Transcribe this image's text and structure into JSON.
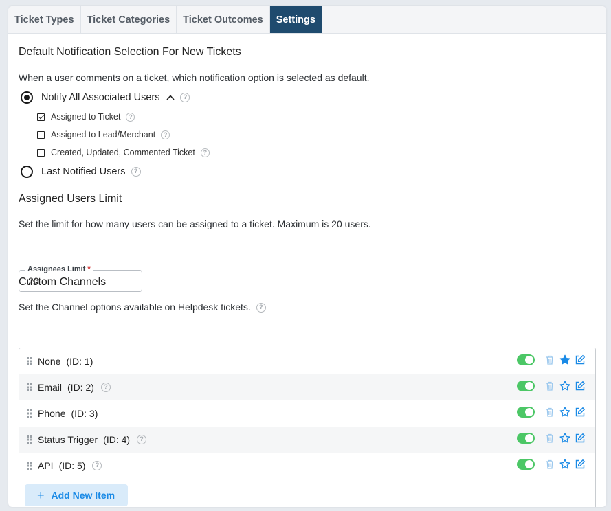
{
  "tabs": [
    {
      "label": "Ticket Types",
      "active": false
    },
    {
      "label": "Ticket Categories",
      "active": false
    },
    {
      "label": "Ticket Outcomes",
      "active": false
    },
    {
      "label": "Settings",
      "active": true
    }
  ],
  "notification": {
    "heading": "Default Notification Selection For New Tickets",
    "description": "When a user comments on a ticket, which notification option is selected as default.",
    "options": [
      {
        "label": "Notify All Associated Users",
        "selected": true
      },
      {
        "label": "Last Notified Users",
        "selected": false
      }
    ],
    "suboptions": [
      {
        "label": "Assigned to Ticket",
        "checked": true
      },
      {
        "label": "Assigned to Lead/Merchant",
        "checked": false
      },
      {
        "label": "Created, Updated, Commented Ticket",
        "checked": false
      }
    ]
  },
  "assigned_limit": {
    "heading": "Assigned Users Limit",
    "description": "Set the limit for how many users can be assigned to a ticket. Maximum is 20 users.",
    "field_label": "Assignees Limit",
    "required_mark": "*",
    "value": "20"
  },
  "channels": {
    "heading": "Custom Channels",
    "description": "Set the Channel options available on Helpdesk tickets.",
    "items": [
      {
        "name": "None",
        "id": "(ID: 1)",
        "help": false,
        "enabled": true,
        "default": true
      },
      {
        "name": "Email",
        "id": "(ID: 2)",
        "help": true,
        "enabled": true,
        "default": false
      },
      {
        "name": "Phone",
        "id": "(ID: 3)",
        "help": false,
        "enabled": true,
        "default": false
      },
      {
        "name": "Status Trigger",
        "id": "(ID: 4)",
        "help": true,
        "enabled": true,
        "default": false
      },
      {
        "name": "API",
        "id": "(ID: 5)",
        "help": true,
        "enabled": true,
        "default": false
      }
    ],
    "add_label": "Add New Item",
    "add_icon": "+"
  },
  "help_glyph": "?",
  "colors": {
    "active_tab": "#1f4b6e",
    "toggle_on": "#4cc766",
    "accent": "#1a8ae6",
    "add_button_bg": "#d9ebfa"
  }
}
